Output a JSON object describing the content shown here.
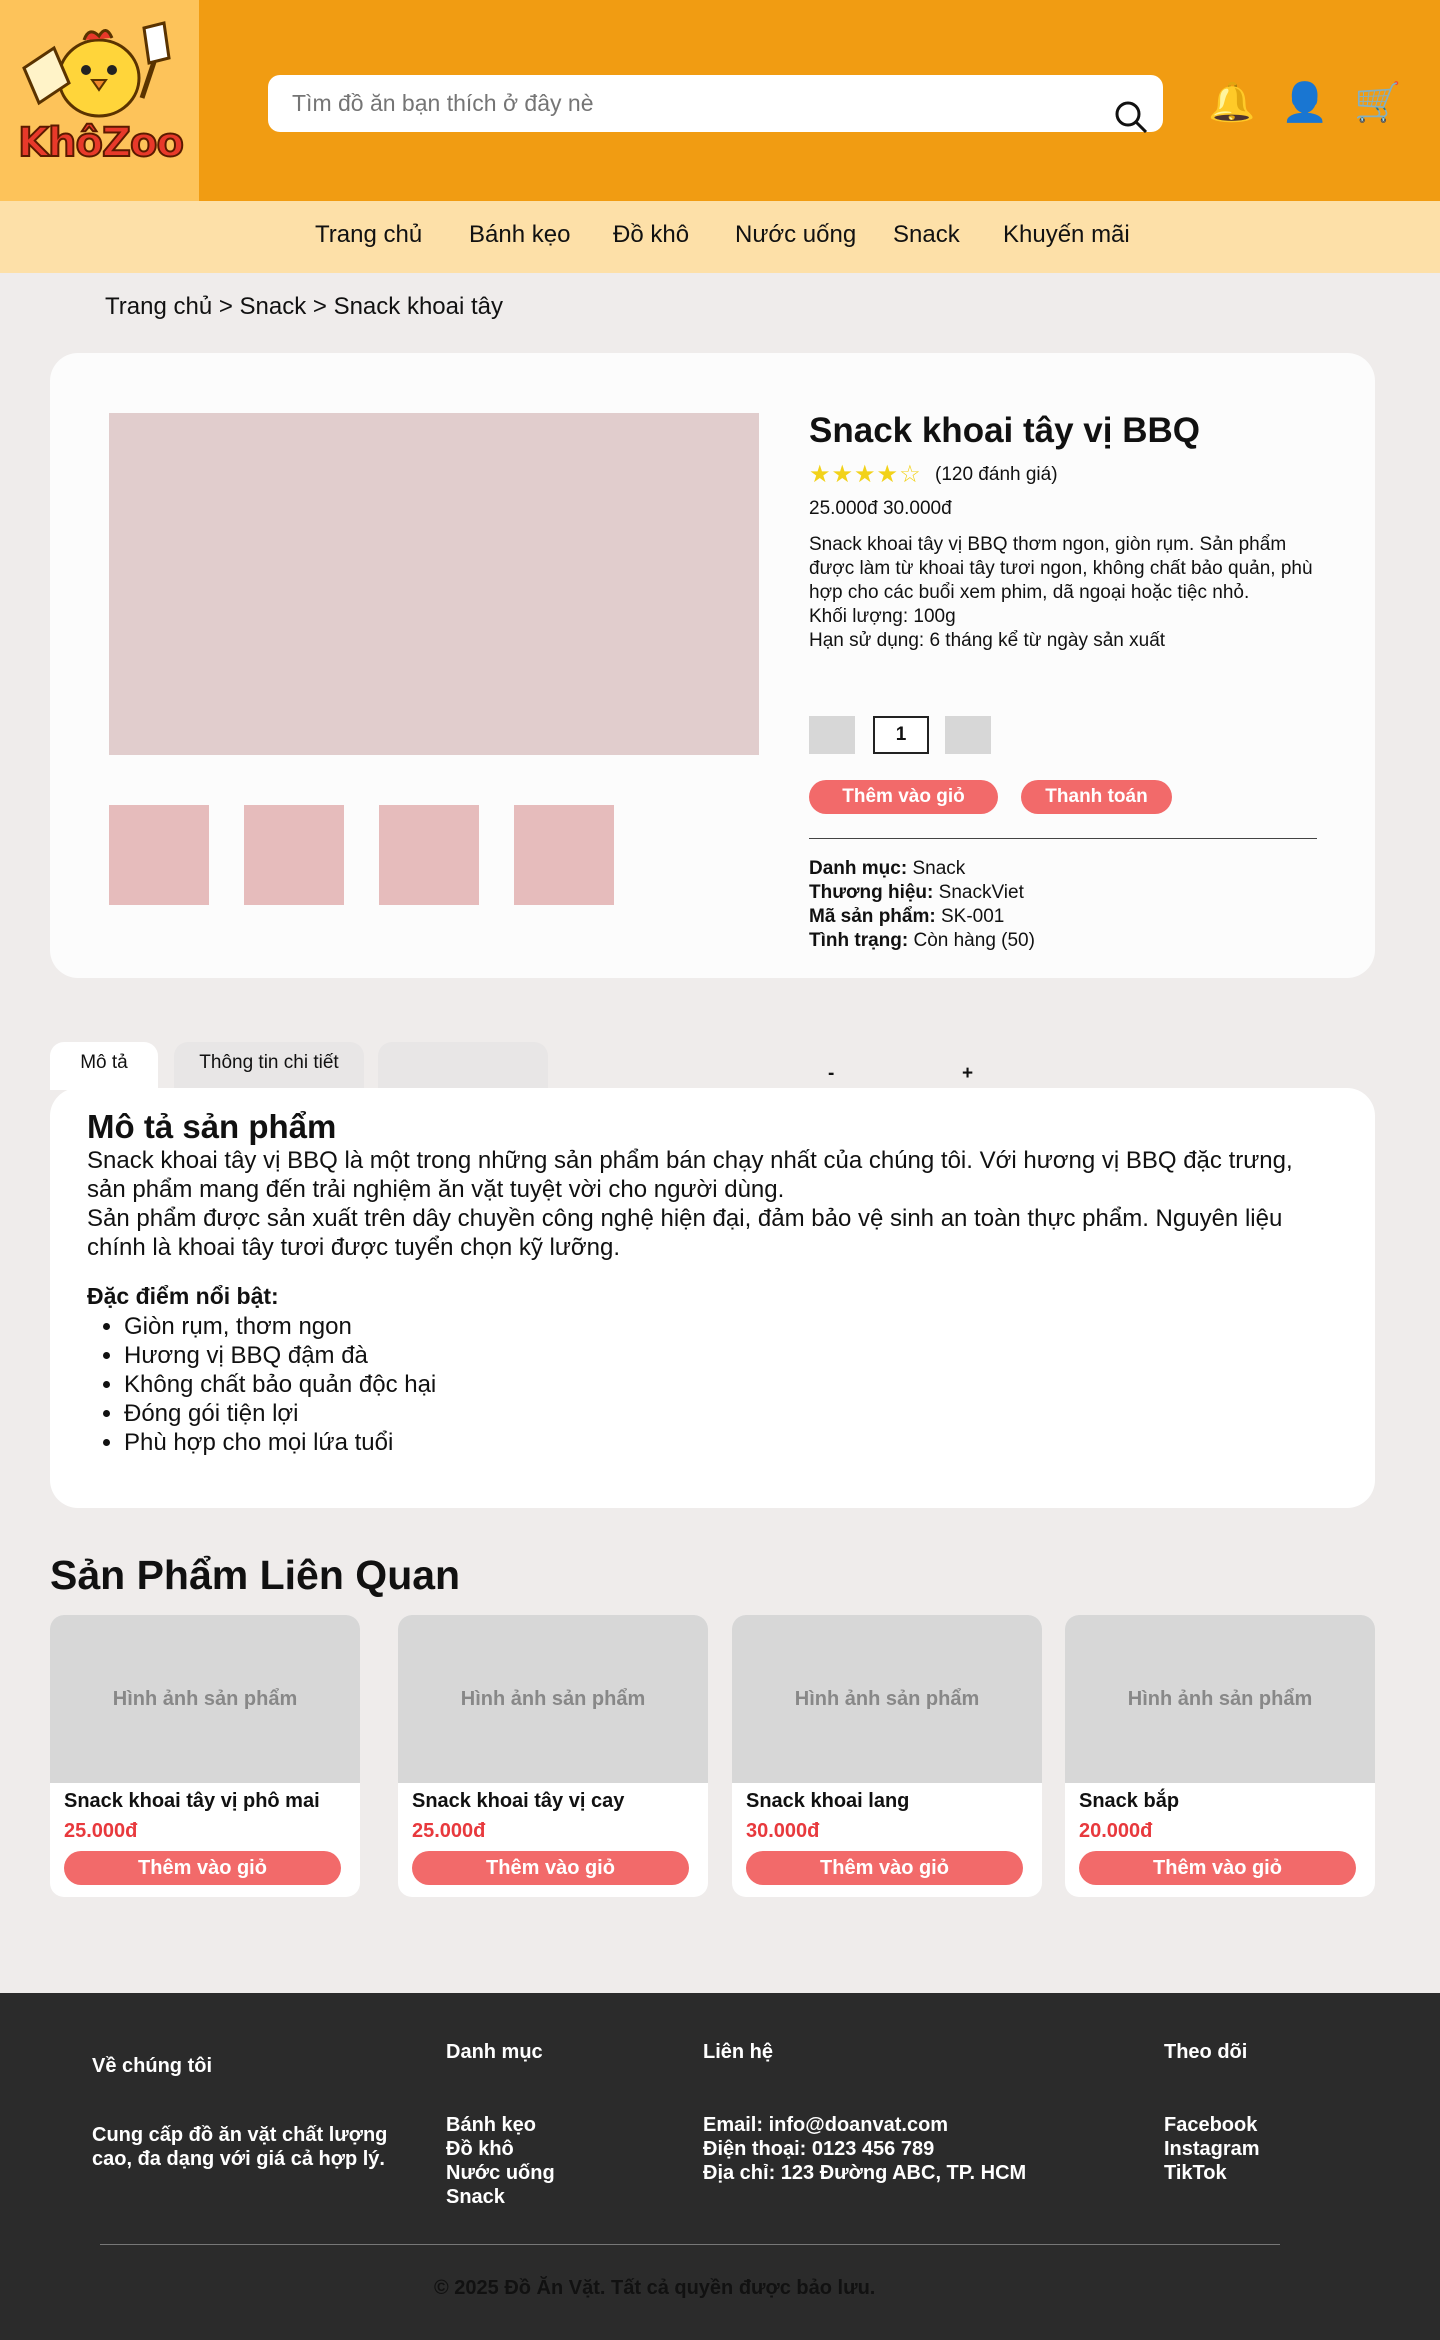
{
  "header": {
    "logo_text": "KhôZoo",
    "search_placeholder": "Tìm đồ ăn bạn thích ở đây nè",
    "icons": [
      "search-icon",
      "bell-icon",
      "user-icon",
      "cart-icon"
    ],
    "bell_glyph": "🔔",
    "user_glyph": "👤",
    "cart_glyph": "🛒"
  },
  "nav": {
    "items": [
      "Trang chủ",
      "Bánh kẹo",
      "Đồ khô",
      "Nước uống",
      "Snack",
      "Khuyến mãi"
    ]
  },
  "breadcrumb": "Trang chủ > Snack > Snack khoai tây",
  "product": {
    "name": "Snack khoai tây vị BBQ",
    "stars": "★★★★☆",
    "rating_value": 4,
    "reviews": "(120 đánh giá)",
    "price": "25.000đ 30.000đ",
    "description": "Snack khoai tây vị BBQ thơm ngon, giòn rụm. Sản phẩm được làm từ khoai tây tươi ngon, không chất bảo quản, phù hợp cho các buổi xem phim, dã ngoại hoặc tiệc nhỏ.",
    "weight": "Khối lượng: 100g",
    "expiry": "Hạn sử dụng: 6 tháng kể từ ngày sản xuất",
    "quantity": "1",
    "add_to_cart": "Thêm vào giỏ",
    "checkout": "Thanh toán",
    "meta": [
      {
        "label": "Danh mục:",
        "value": "Snack"
      },
      {
        "label": "Thương hiệu:",
        "value": "SnackViet"
      },
      {
        "label": "Mã sản phẩm:",
        "value": "SK-001"
      },
      {
        "label": "Tình trạng:",
        "value": "Còn hàng (50)"
      }
    ]
  },
  "tabs": {
    "items": [
      "Mô tả",
      "Thông tin chi tiết",
      ""
    ],
    "minus": "-",
    "plus": "+"
  },
  "description_section": {
    "title": "Mô tả sản phẩm",
    "paragraphs": [
      "Snack khoai tây vị BBQ là một trong những sản phẩm bán chạy nhất của chúng tôi. Với hương vị BBQ đặc trưng, sản phẩm mang đến trải nghiệm ăn vặt tuyệt vời cho người dùng.",
      "Sản phẩm được sản xuất trên dây chuyền công nghệ hiện đại, đảm bảo vệ sinh an toàn thực phẩm. Nguyên liệu chính là khoai tây tươi được tuyển chọn kỹ lưỡng."
    ],
    "features_label": "Đặc điểm nổi bật:",
    "features": [
      "Giòn rụm, thơm ngon",
      "Hương vị BBQ đậm đà",
      "Không chất bảo quản độc hại",
      "Đóng gói tiện lợi",
      "Phù hợp cho mọi lứa tuổi"
    ]
  },
  "related": {
    "title": "Sản Phẩm Liên Quan",
    "items": [
      {
        "image": "Hình ảnh sản phẩm",
        "name": "Snack khoai tây vị phô mai",
        "price": "25.000đ",
        "button": "Thêm vào giỏ"
      },
      {
        "image": "Hình ảnh sản phẩm",
        "name": "Snack khoai tây vị cay",
        "price": "25.000đ",
        "button": "Thêm vào giỏ"
      },
      {
        "image": "Hình ảnh sản phẩm",
        "name": "Snack khoai lang",
        "price": "30.000đ",
        "button": "Thêm vào giỏ"
      },
      {
        "image": "Hình ảnh sản phẩm",
        "name": "Snack bắp",
        "price": "20.000đ",
        "button": "Thêm vào giỏ"
      }
    ]
  },
  "footer": {
    "about_title": "Về chúng tôi",
    "about_text": "Cung cấp đồ ăn vặt chất lượng cao, đa dạng với giá cả hợp lý.",
    "categories_title": "Danh mục",
    "categories": [
      "Bánh kẹo",
      "Đồ khô",
      "Nước uống",
      "Snack"
    ],
    "contact_title": "Liên hệ",
    "contact": [
      "Email: info@doanvat.com",
      "Điện thoại: 0123 456 789",
      "Địa chỉ: 123 Đường ABC, TP. HCM"
    ],
    "follow_title": "Theo dõi",
    "follow": [
      "Facebook",
      "Instagram",
      "TikTok"
    ],
    "copyright": "© 2025 Đồ Ăn Vặt. Tất cả quyền được bảo lưu."
  },
  "colors": {
    "header": "#f19c12",
    "nav": "#fde0a8",
    "accent": "#f26a6a",
    "price": "#e8393d",
    "footer": "#2b2b2b"
  }
}
